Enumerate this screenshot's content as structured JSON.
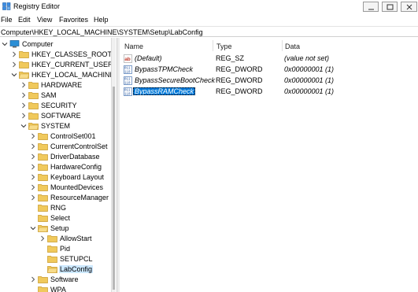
{
  "window": {
    "title": "Registry Editor"
  },
  "menu": [
    "File",
    "Edit",
    "View",
    "Favorites",
    "Help"
  ],
  "address": "Computer\\HKEY_LOCAL_MACHINE\\SYSTEM\\Setup\\LabConfig",
  "tree": [
    {
      "label": "Computer",
      "expanded": true,
      "selected": false
    },
    {
      "label": "HKEY_CLASSES_ROOT",
      "expanded": false,
      "selected": false
    },
    {
      "label": "HKEY_CURRENT_USER",
      "expanded": false,
      "selected": false
    },
    {
      "label": "HKEY_LOCAL_MACHINE",
      "expanded": true,
      "selected": false
    },
    {
      "label": "HARDWARE",
      "expanded": false,
      "selected": false
    },
    {
      "label": "SAM",
      "expanded": false,
      "selected": false
    },
    {
      "label": "SECURITY",
      "expanded": false,
      "selected": false
    },
    {
      "label": "SOFTWARE",
      "expanded": false,
      "selected": false
    },
    {
      "label": "SYSTEM",
      "expanded": true,
      "selected": false
    },
    {
      "label": "ControlSet001",
      "expanded": false,
      "selected": false
    },
    {
      "label": "CurrentControlSet",
      "expanded": false,
      "selected": false
    },
    {
      "label": "DriverDatabase",
      "expanded": false,
      "selected": false
    },
    {
      "label": "HardwareConfig",
      "expanded": false,
      "selected": false
    },
    {
      "label": "Keyboard Layout",
      "expanded": false,
      "selected": false
    },
    {
      "label": "MountedDevices",
      "expanded": false,
      "selected": false
    },
    {
      "label": "ResourceManager",
      "expanded": false,
      "selected": false
    },
    {
      "label": "RNG",
      "expanded": false,
      "selected": false
    },
    {
      "label": "Select",
      "expanded": false,
      "selected": false
    },
    {
      "label": "Setup",
      "expanded": true,
      "selected": false
    },
    {
      "label": "AllowStart",
      "expanded": false,
      "selected": false
    },
    {
      "label": "Pid",
      "expanded": false,
      "selected": false
    },
    {
      "label": "SETUPCL",
      "expanded": false,
      "selected": false
    },
    {
      "label": "LabConfig",
      "expanded": false,
      "selected": true
    },
    {
      "label": "Software",
      "expanded": false,
      "selected": false
    },
    {
      "label": "WPA",
      "expanded": false,
      "selected": false
    }
  ],
  "columns": {
    "name": "Name",
    "type": "Type",
    "data": "Data"
  },
  "values": [
    {
      "name": "(Default)",
      "type": "REG_SZ",
      "data": "(value not set)",
      "icon": "string-value-icon",
      "selected": false
    },
    {
      "name": "BypassTPMCheck",
      "type": "REG_DWORD",
      "data": "0x00000001 (1)",
      "icon": "binary-value-icon",
      "selected": false
    },
    {
      "name": "BypassSecureBootCheck",
      "type": "REG_DWORD",
      "data": "0x00000001 (1)",
      "icon": "binary-value-icon",
      "selected": false
    },
    {
      "name": "BypassRAMCheck",
      "type": "REG_DWORD",
      "data": "0x00000001 (1)",
      "icon": "binary-value-icon",
      "selected": true
    }
  ],
  "colors": {
    "folder": "#f0c95c",
    "selection": "#0078d7",
    "tree_selection": "#cce8ff"
  }
}
